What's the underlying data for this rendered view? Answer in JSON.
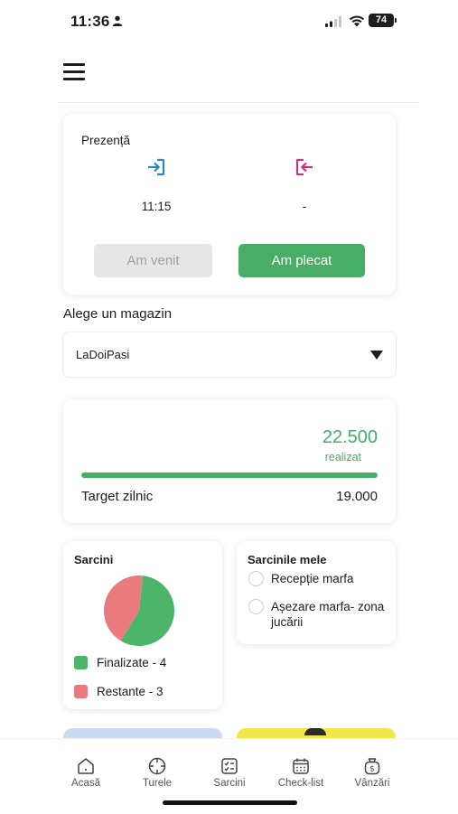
{
  "status_bar": {
    "time": "11:36",
    "battery": "74"
  },
  "presence": {
    "title": "Prezență",
    "checkin_time": "11:15",
    "checkout_time": "-",
    "came_label": "Am venit",
    "left_label": "Am plecat"
  },
  "store": {
    "label": "Alege un magazin",
    "selected": "LaDoiPasi"
  },
  "target": {
    "achieved_value": "22.500",
    "achieved_label": "realizat",
    "label": "Target zilnic",
    "goal": "19.000",
    "progress": 1.0
  },
  "tasks": {
    "title": "Sarcini",
    "legend_done": "Finalizate - 4",
    "legend_remaining": "Restante - 3",
    "colors": {
      "done": "#4db56a",
      "remaining": "#e97b7f"
    }
  },
  "chart_data": {
    "type": "pie",
    "title": "Sarcini",
    "categories": [
      "Finalizate",
      "Restante"
    ],
    "values": [
      4,
      3
    ],
    "colors": [
      "#4db56a",
      "#e97b7f"
    ]
  },
  "my_tasks": {
    "title": "Sarcinile mele",
    "items": [
      {
        "label": "Recepție marfa"
      },
      {
        "label": "Așezare marfa- zona jucării"
      }
    ]
  },
  "nav": [
    {
      "label": "Acasă",
      "icon": "home-icon"
    },
    {
      "label": "Turele",
      "icon": "crosshair-icon"
    },
    {
      "label": "Sarcini",
      "icon": "checklist-icon"
    },
    {
      "label": "Check-list",
      "icon": "calendar-icon"
    },
    {
      "label": "Vânzări",
      "icon": "money-bag-icon"
    }
  ],
  "colors": {
    "accent": "#48ad66",
    "checkin_icon": "#2f86b5",
    "checkout_icon": "#c7357e"
  }
}
